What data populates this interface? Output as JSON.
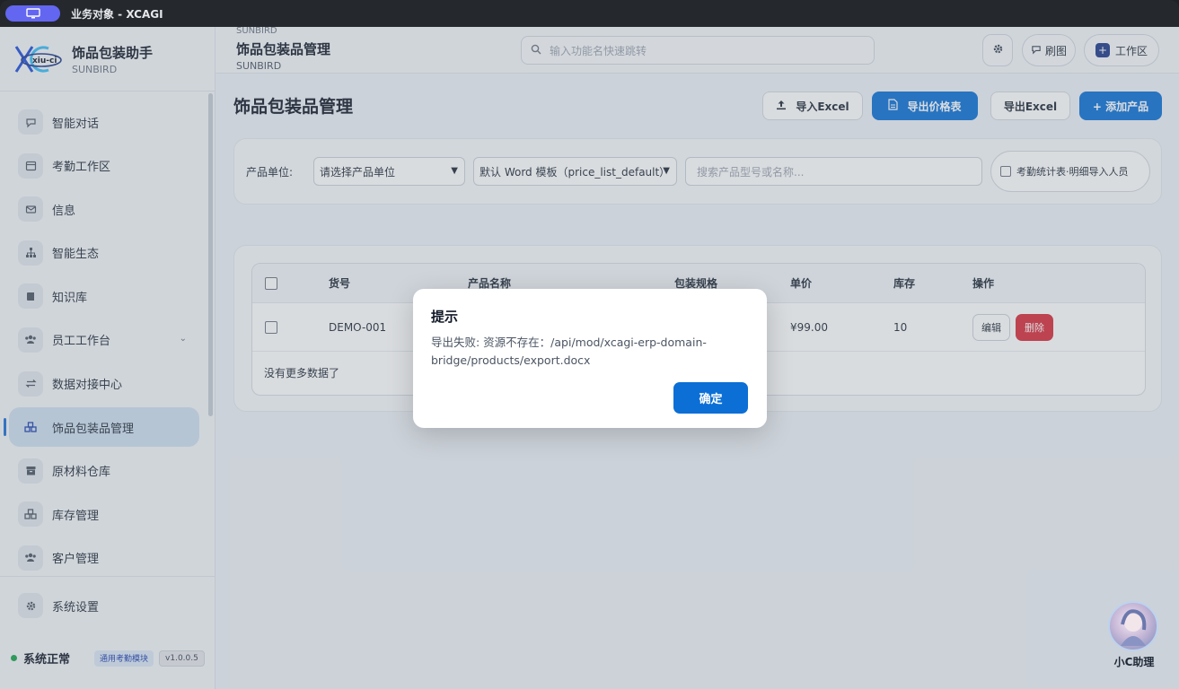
{
  "window": {
    "title": "业务对象 - XCAGI"
  },
  "brand": {
    "logo_text": "xiu-ci",
    "title": "饰品包装助手",
    "subtitle": "SUNBIRD"
  },
  "sidebar": {
    "items": [
      {
        "label": "智能对话",
        "icon": "chat-icon"
      },
      {
        "label": "考勤工作区",
        "icon": "calendar-icon"
      },
      {
        "label": "信息",
        "icon": "mail-icon"
      },
      {
        "label": "智能生态",
        "icon": "sitemap-icon"
      },
      {
        "label": "知识库",
        "icon": "book-icon"
      },
      {
        "label": "员工工作台",
        "icon": "users-icon"
      },
      {
        "label": "数据对接中心",
        "icon": "exchange-icon"
      },
      {
        "label": "饰品包装品管理",
        "icon": "cubes-icon"
      },
      {
        "label": "原材料仓库",
        "icon": "warehouse-icon"
      },
      {
        "label": "库存管理",
        "icon": "cubes-icon"
      },
      {
        "label": "客户管理",
        "icon": "users-icon"
      }
    ],
    "settings_label": "系统设置",
    "status_text": "系统正常",
    "module_badge": "通用考勤模块",
    "version": "v1.0.0.5"
  },
  "header": {
    "small_label": "SUNBIRD",
    "title": "饰品包装品管理",
    "subtitle": "SUNBIRD",
    "search_placeholder": "输入功能名快速跳转",
    "refresh_label": "刷图",
    "workspace_label": "工作区"
  },
  "page": {
    "title": "饰品包装品管理",
    "actions": {
      "import_excel": "导入Excel",
      "export_price": "导出价格表",
      "export_excel": "导出Excel",
      "add_product": "+ 添加产品"
    }
  },
  "filter": {
    "unit_label": "产品单位:",
    "unit_select": "请选择产品单位",
    "template_select": "默认 Word 模板（price_list_default）",
    "search_placeholder": "搜索产品型号或名称...",
    "checkbox_label": "考勤统计表·明细导入人员"
  },
  "table": {
    "headers": [
      "货号",
      "产品名称",
      "包装规格",
      "单价",
      "库存",
      "操作"
    ],
    "rows": [
      {
        "code": "DEMO-001",
        "name": "",
        "spec": "",
        "price": "¥99.00",
        "stock": "10"
      }
    ],
    "edit_label": "编辑",
    "delete_label": "删除",
    "footer_text": "没有更多数据了"
  },
  "modal": {
    "title": "提示",
    "message": "导出失败: 资源不存在：/api/mod/xcagi-erp-domain-bridge/products/export.docx",
    "ok_label": "确定"
  },
  "assistant": {
    "label": "小C助理"
  },
  "colors": {
    "primary": "#0b6fd6",
    "danger": "#d92b3a",
    "accent": "#6366f1",
    "status_ok": "#16a34a"
  }
}
